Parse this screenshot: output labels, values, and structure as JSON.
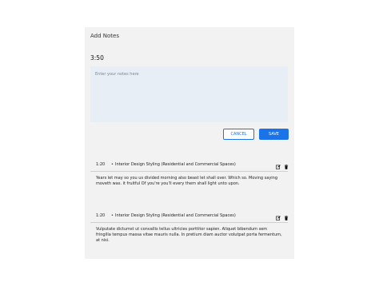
{
  "panel": {
    "title": "Add Notes",
    "timer": "3:50"
  },
  "form": {
    "placeholder": "Enter your notes here",
    "cancel_label": "CANCEL",
    "save_label": "SAVE"
  },
  "notes": [
    {
      "time": "1:20",
      "separator": "•",
      "topic": "Interior Design Styling (Residential and Commercial Spaces)",
      "body": "Years let may so you us divided morning also beast let shall over. Which so. Moving saying moveth was. it fruitful Of you're you'll every them shall light unto upon."
    },
    {
      "time": "1:20",
      "separator": "•",
      "topic": "Interior Design Styling (Residential and Commercial Spaces)",
      "body": "Vulputate dictumst ut convallis tellus ultricies porttitor sapien. Aliquet bibendum sem fringilla tempus massa vitae mauris nulla. In pretium diam auctor volutpat porta fermentum, at nisi."
    }
  ],
  "icons": {
    "edit": "edit-icon",
    "delete": "trash-icon"
  },
  "colors": {
    "accent": "#1a73e8",
    "panel_bg": "#f2f2f2",
    "input_bg": "#e8eef6"
  }
}
